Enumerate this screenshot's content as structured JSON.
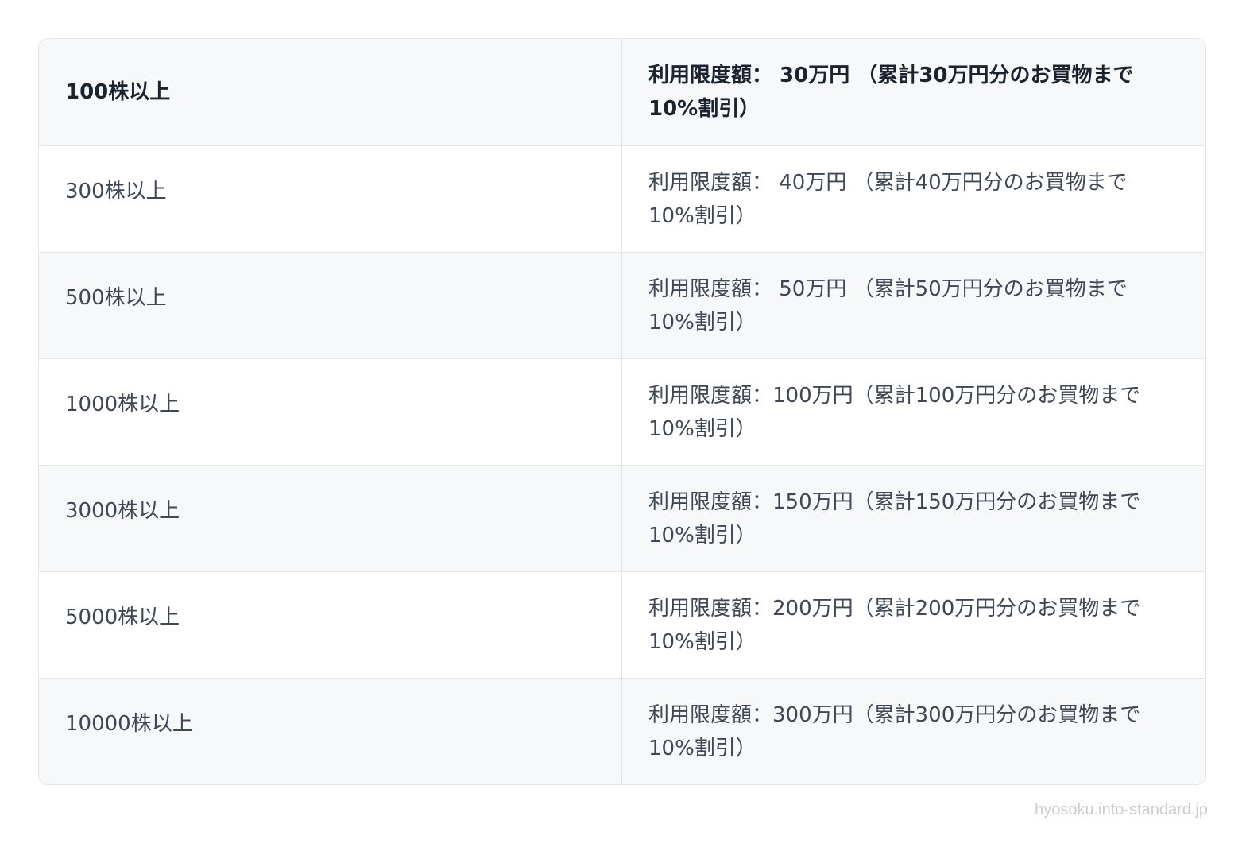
{
  "table": {
    "rows": [
      {
        "shares": "100株以上",
        "benefit": "利用限度額： 30万円 （累計30万円分のお買物まで\n10%割引）"
      },
      {
        "shares": "300株以上",
        "benefit": "利用限度額： 40万円 （累計40万円分のお買物まで\n10%割引）"
      },
      {
        "shares": "500株以上",
        "benefit": "利用限度額： 50万円 （累計50万円分のお買物まで\n10%割引）"
      },
      {
        "shares": "1000株以上",
        "benefit": "利用限度額：100万円（累計100万円分のお買物まで\n10%割引）"
      },
      {
        "shares": "3000株以上",
        "benefit": "利用限度額：150万円（累計150万円分のお買物まで\n10%割引）"
      },
      {
        "shares": "5000株以上",
        "benefit": "利用限度額：200万円（累計200万円分のお買物まで\n10%割引）"
      },
      {
        "shares": "10000株以上",
        "benefit": "利用限度額：300万円（累計300万円分のお買物まで\n10%割引）"
      }
    ]
  },
  "footer": {
    "watermark": "hyosoku.into-standard.jp"
  },
  "colors": {
    "border": "#e3e6e9",
    "stripe": "#f7f8f9",
    "text": "#3f4754",
    "header_text": "#1b2330",
    "watermark": "#c9ccd0"
  }
}
